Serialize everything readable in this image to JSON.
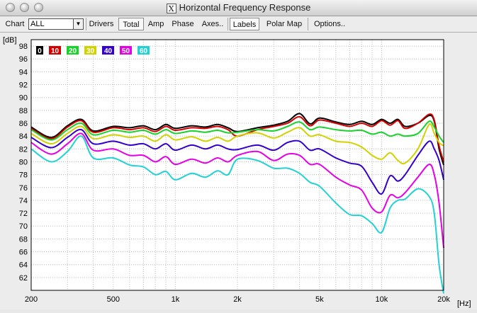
{
  "window": {
    "title": "Horizontal Frequency Response",
    "title_icon": "X"
  },
  "toolbar": {
    "chart_label": "Chart",
    "chart_select_value": "ALL",
    "buttons": [
      "Drivers",
      "Total",
      "Amp",
      "Phase",
      "Axes..",
      "Labels",
      "Polar Map",
      "Options.."
    ]
  },
  "colors": {
    "plot_bg": "#ffffff",
    "grid": "#b8b8b8",
    "series": [
      "#000000",
      "#d40000",
      "#19d22c",
      "#d2d200",
      "#3300cc",
      "#e600e6",
      "#22d2d2"
    ]
  },
  "chart_data": {
    "type": "line",
    "ylabel": "[dB]",
    "xlabel": "[Hz]",
    "xlim": [
      200,
      20000
    ],
    "ylim": [
      60,
      99
    ],
    "x_scale": "log",
    "grid": true,
    "legend_placement": "top-left",
    "x_tick_labels": [
      "200",
      "500",
      "1k",
      "2k",
      "5k",
      "10k",
      "20k"
    ],
    "x_tick_values": [
      200,
      500,
      1000,
      2000,
      5000,
      10000,
      20000
    ],
    "y_tick_values": [
      62,
      64,
      66,
      68,
      70,
      72,
      74,
      76,
      78,
      80,
      82,
      84,
      86,
      88,
      90,
      92,
      94,
      96,
      98
    ],
    "x": [
      200,
      250,
      300,
      350,
      400,
      500,
      600,
      700,
      800,
      900,
      1000,
      1200,
      1400,
      1600,
      1800,
      2000,
      2500,
      3000,
      3500,
      4000,
      4500,
      5000,
      6000,
      7000,
      8000,
      9000,
      10000,
      11000,
      12000,
      13000,
      15000,
      17000,
      18000,
      19000,
      20000
    ],
    "series": [
      {
        "name": "0",
        "values": [
          85.4,
          83.8,
          85.6,
          86.6,
          84.8,
          85.5,
          85.3,
          85.6,
          85.0,
          85.8,
          85.2,
          85.6,
          85.4,
          85.8,
          85.3,
          84.7,
          85.3,
          85.7,
          86.3,
          87.5,
          85.9,
          86.8,
          86.2,
          85.8,
          86.3,
          85.8,
          86.6,
          86.0,
          86.6,
          85.5,
          86.0,
          87.2,
          86.3,
          82.0,
          79.5
        ]
      },
      {
        "name": "10",
        "values": [
          85.2,
          83.6,
          85.4,
          86.4,
          84.6,
          85.3,
          85.0,
          85.3,
          84.7,
          85.5,
          84.9,
          85.3,
          85.2,
          85.5,
          85.0,
          84.0,
          85.0,
          85.5,
          86.0,
          87.0,
          85.6,
          86.5,
          86.0,
          85.5,
          86.0,
          85.5,
          86.4,
          85.7,
          86.4,
          85.2,
          86.0,
          87.4,
          86.5,
          82.5,
          80.0
        ]
      },
      {
        "name": "20",
        "values": [
          85.0,
          83.4,
          85.0,
          86.0,
          84.2,
          84.9,
          84.6,
          84.9,
          84.3,
          85.0,
          84.4,
          84.8,
          84.6,
          84.9,
          84.5,
          84.6,
          85.0,
          84.8,
          85.5,
          86.2,
          85.0,
          85.4,
          85.0,
          84.8,
          84.9,
          84.3,
          84.6,
          84.0,
          84.3,
          84.0,
          84.4,
          86.3,
          85.4,
          84.0,
          83.0
        ]
      },
      {
        "name": "30",
        "values": [
          84.4,
          82.8,
          84.4,
          85.5,
          83.6,
          84.2,
          83.8,
          84.0,
          83.2,
          84.2,
          83.4,
          83.9,
          83.2,
          83.8,
          83.2,
          84.0,
          84.5,
          83.7,
          84.6,
          85.3,
          84.0,
          84.2,
          83.2,
          83.0,
          82.3,
          81.0,
          80.4,
          81.4,
          80.2,
          79.8,
          82.0,
          85.8,
          84.4,
          83.0,
          82.5
        ]
      },
      {
        "name": "40",
        "values": [
          83.8,
          82.2,
          83.8,
          85.0,
          82.8,
          83.2,
          82.6,
          82.8,
          82.0,
          82.8,
          81.8,
          82.6,
          82.0,
          82.6,
          82.0,
          81.9,
          82.6,
          81.8,
          83.0,
          83.2,
          81.8,
          82.0,
          80.6,
          79.8,
          79.3,
          76.8,
          75.0,
          77.8,
          77.0,
          78.0,
          81.0,
          83.2,
          82.0,
          80.2,
          77.2
        ]
      },
      {
        "name": "50",
        "values": [
          83.0,
          81.2,
          82.8,
          84.4,
          81.8,
          82.0,
          81.0,
          81.0,
          80.0,
          80.8,
          79.6,
          80.4,
          79.8,
          80.6,
          80.0,
          81.0,
          81.6,
          80.2,
          81.2,
          81.0,
          79.6,
          79.6,
          77.6,
          76.4,
          75.6,
          72.8,
          72.2,
          74.8,
          74.4,
          75.2,
          77.6,
          79.6,
          78.0,
          73.6,
          66.6
        ]
      },
      {
        "name": "60",
        "values": [
          82.0,
          80.0,
          81.6,
          84.0,
          80.6,
          80.6,
          79.5,
          79.2,
          78.0,
          78.5,
          77.2,
          78.2,
          77.6,
          78.6,
          78.0,
          80.4,
          80.2,
          79.0,
          79.0,
          78.2,
          76.8,
          76.2,
          73.6,
          71.8,
          71.6,
          70.4,
          69.0,
          72.8,
          74.0,
          74.2,
          75.8,
          74.6,
          72.0,
          64.0,
          59.5
        ]
      }
    ]
  }
}
